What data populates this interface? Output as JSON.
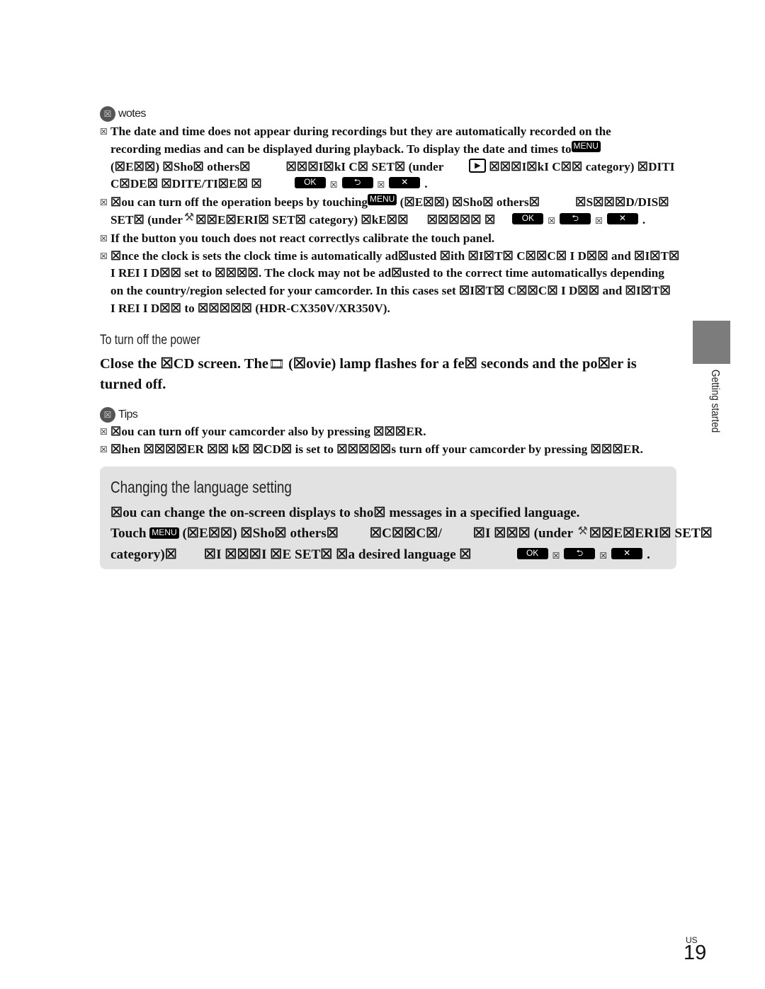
{
  "notes": {
    "icon": "notes-icon",
    "badge_glyph": "☒",
    "label": "wotes",
    "bullet_glyph": "☒",
    "items": [
      {
        "lines": [
          [
            "The date and time does not appear during recordings but they are automatically recorded on the"
          ],
          [
            "recording medias and can be displayed during playback. To display the date and times to",
            "MENU"
          ],
          [
            "(☒E☒☒) ☒Sho☒ others☒",
            "",
            "☒☒☒I☒kI C☒ SET☒ (under",
            "PLAY",
            "☒☒☒I☒kI C☒☒ category)  ☒DITI"
          ],
          [
            "C☒DE☒ ☒DITE/TI☒E☒ ☒",
            "OK",
            "☒",
            "BACK",
            "☒",
            "CLOSE",
            "."
          ]
        ]
      },
      {
        "lines": [
          [
            "☒ou can turn off the operation beeps by touching",
            "MENU",
            "(☒E☒☒) ☒Sho☒ others☒",
            "",
            "☒S☒☒☒D/DIS☒"
          ],
          [
            "SET☒ (under",
            "WRENCH",
            "☒☒E☒ERI☒ SET☒ category)  ☒kE☒☒",
            "☒☒☒☒☒ ☒",
            "OK",
            "☒",
            "BACK",
            "☒",
            "CLOSE",
            "."
          ]
        ]
      },
      {
        "lines": [
          [
            "If the button you touch does not react correctlys calibrate the touch panel."
          ]
        ]
      },
      {
        "lines": [
          [
            "☒nce the clock is sets the clock time is automatically ad☒usted ☒ith ☒I☒T☒ C☒☒C☒ I D☒☒ and ☒I☒T☒"
          ],
          [
            "I REI  I D☒☒ set to ☒☒☒☒. The clock may not be ad☒usted to the correct time automaticallys depending"
          ],
          [
            "on the country/region selected for your camcorder. In this cases set ☒I☒T☒ C☒☒C☒ I D☒☒ and ☒I☒T☒"
          ],
          [
            "I REI  I D☒☒ to ☒☒☒☒☒  (HDR-CX350V/XR350V)."
          ]
        ]
      }
    ]
  },
  "power_section": {
    "subheading": "To turn off the power",
    "instruction_part1": "Close the ☒CD screen. The",
    "film_icon": "film-icon",
    "instruction_part2": "(☒ovie) lamp flashes for a fe☒ seconds and the po☒er is turned off."
  },
  "tips": {
    "icon": "tips-icon",
    "badge_glyph": "☒",
    "label": "Tips",
    "items": [
      "☒ou can turn off your camcorder also by pressing ☒☒☒ER.",
      "☒hen ☒☒☒☒ER ☒☒ k☒ ☒CD☒ is set to ☒☒☒☒☒s turn off your camcorder by pressing ☒☒☒ER."
    ]
  },
  "language_box": {
    "title": "Changing the language setting",
    "line1": "☒ou can change the on-screen displays to sho☒ messages in a specified language.",
    "line2_a": "Touch",
    "line2_b": "(☒E☒☒) ☒Sho☒ others☒",
    "line2_c": "☒C☒☒C☒/",
    "line2_d": "☒I ☒☒☒ (under",
    "line2_e": "☒☒E☒ERI☒ SET☒",
    "line3_a": "category)☒",
    "line3_b": "☒I ☒☒☒I ☒E SET☒ ☒a desired language ☒",
    "sep": "☒",
    "period": "."
  },
  "buttons": {
    "menu": "MENU",
    "ok": "OK",
    "back": "⮌",
    "close": "✕",
    "play": "▶",
    "wrench": "🔧"
  },
  "side_tab": {
    "label": "Getting started",
    "color": "#7c7c7c"
  },
  "footer": {
    "region": "US",
    "page_number": "19"
  }
}
